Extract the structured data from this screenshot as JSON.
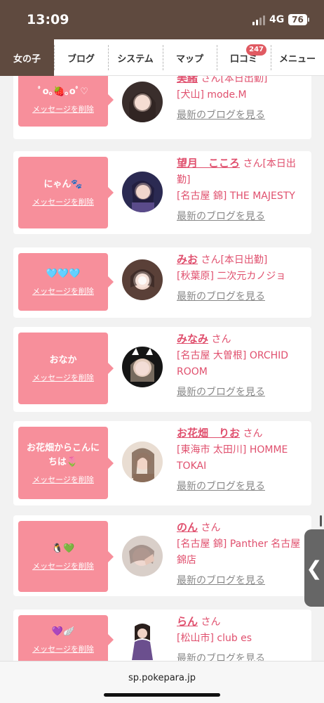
{
  "status": {
    "time": "13:09",
    "network": "4G",
    "battery": "76"
  },
  "tabs": [
    {
      "label": "女の子",
      "active": true,
      "badge": ""
    },
    {
      "label": "ブログ",
      "active": false,
      "badge": ""
    },
    {
      "label": "システム",
      "active": false,
      "badge": ""
    },
    {
      "label": "マップ",
      "active": false,
      "badge": ""
    },
    {
      "label": "口コミ",
      "active": false,
      "badge": "247"
    },
    {
      "label": "メニュー",
      "active": false,
      "badge": ""
    }
  ],
  "messages": [
    {
      "message": "ﾟo｡🍓｡oﾟ♡",
      "delete_label": "メッセージを削除",
      "name": "美緒",
      "suffix": "さん[本日出勤]",
      "shop": "[犬山] mode.M",
      "blog_link": "最新のブログを見る"
    },
    {
      "message": "にゃん🐾",
      "delete_label": "メッセージを削除",
      "name": "望月　こころ",
      "suffix": "さん[本日出勤]",
      "shop": "[名古屋 錦] THE MAJESTY",
      "blog_link": "最新のブログを見る"
    },
    {
      "message": "🩵🩵🩵",
      "delete_label": "メッセージを削除",
      "name": "みお",
      "suffix": "さん[本日出勤]",
      "shop": "[秋葉原] 二次元カノジョ",
      "blog_link": "最新のブログを見る"
    },
    {
      "message": "おなか",
      "delete_label": "メッセージを削除",
      "name": "みなみ",
      "suffix": "さん",
      "shop": "[名古屋 大曽根] ORCHID ROOM",
      "blog_link": "最新のブログを見る"
    },
    {
      "message": "お花畑からこんにちは🌷",
      "delete_label": "メッセージを削除",
      "name": "お花畑　りお",
      "suffix": "さん",
      "shop": "[東海市 太田川] HOMME TOKAI",
      "blog_link": "最新のブログを見る"
    },
    {
      "message": "🐧💚",
      "delete_label": "メッセージを削除",
      "name": "のん",
      "suffix": "さん",
      "shop": "[名古屋 錦] Panther 名古屋錦店",
      "blog_link": "最新のブログを見る"
    },
    {
      "message": "💜🪽",
      "delete_label": "メッセージを削除",
      "name": "らん",
      "suffix": "さん",
      "shop": "[松山市] club es",
      "blog_link": "最新のブログを見る"
    }
  ],
  "side_tab": {
    "label": "❮"
  },
  "url": "sp.pokepara.jp",
  "colors": {
    "header": "#5f4a3f",
    "bubble": "#f78f9b",
    "name": "#e0506e",
    "badge": "#e05a62"
  }
}
